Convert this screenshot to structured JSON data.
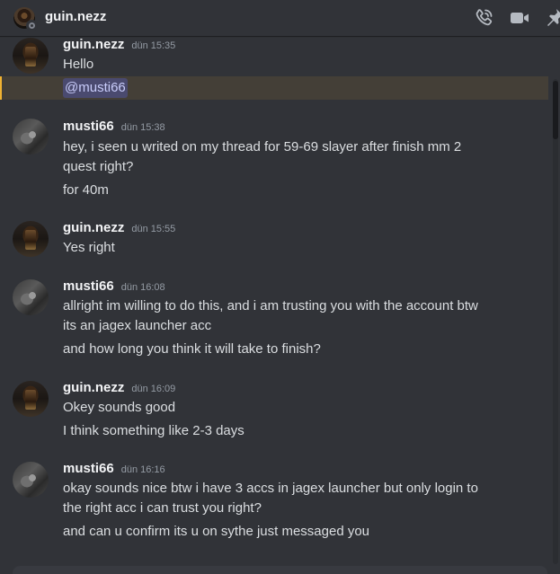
{
  "header": {
    "title": "guin.nezz",
    "icons": [
      "avatar",
      "phone-call-icon",
      "video-call-icon",
      "pin-icon"
    ]
  },
  "colors": {
    "background": "#313338",
    "username": "#f2f3f5",
    "timestamp": "#949ba4",
    "text": "#dbdee1",
    "mention_bg": "#3c4270",
    "mention_highlight": "#f0b232"
  },
  "messages": [
    {
      "username": "guin.nezz",
      "timestamp": "dün 15:35",
      "lines": [
        "Hello"
      ],
      "mention": "@musti66"
    },
    {
      "username": "musti66",
      "timestamp": "dün 15:38",
      "lines": [
        "hey, i seen u writed on my thread for 59-69 slayer after finish mm 2",
        "quest right?",
        "for 40m"
      ]
    },
    {
      "username": "guin.nezz",
      "timestamp": "dün 15:55",
      "lines": [
        "Yes right"
      ]
    },
    {
      "username": "musti66",
      "timestamp": "dün 16:08",
      "lines": [
        "allright im willing to do this, and i am trusting you with the account btw",
        "its an jagex launcher acc",
        "and how long you think it will take to finish?"
      ]
    },
    {
      "username": "guin.nezz",
      "timestamp": "dün 16:09",
      "lines": [
        "Okey sounds good",
        "I think something like 2-3 days"
      ]
    },
    {
      "username": "musti66",
      "timestamp": "dün 16:16",
      "lines": [
        "okay sounds nice btw i have 3 accs in jagex launcher but only login to",
        "the right acc i can trust you right?",
        "and can u confirm its u on sythe just messaged you"
      ]
    }
  ]
}
